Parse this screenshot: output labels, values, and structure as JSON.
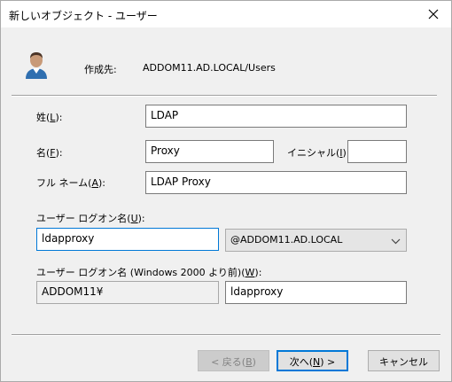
{
  "window": {
    "title": "新しいオブジェクト - ユーザー"
  },
  "header": {
    "create_in_label": "作成先:",
    "create_in_path": "ADDOM11.AD.LOCAL/Users"
  },
  "form": {
    "last_name": {
      "label_pre": "姓(",
      "mnemonic": "L",
      "label_post": "):",
      "value": "LDAP"
    },
    "first_name": {
      "label_pre": "名(",
      "mnemonic": "F",
      "label_post": "):",
      "value": "Proxy"
    },
    "initials": {
      "label_pre": "イニシャル(",
      "mnemonic": "I",
      "label_post": "):",
      "value": ""
    },
    "full_name": {
      "label_pre": "フル ネーム(",
      "mnemonic": "A",
      "label_post": "):",
      "value": "LDAP Proxy"
    },
    "logon_name": {
      "label_pre": "ユーザー ログオン名(",
      "mnemonic": "U",
      "label_post": "):",
      "value": "ldapproxy"
    },
    "upn_suffix": {
      "value": "@ADDOM11.AD.LOCAL"
    },
    "pre2000": {
      "label_pre": "ユーザー ログオン名 (Windows 2000 より前)(",
      "mnemonic": "W",
      "label_post": "):",
      "domain_value": "ADDOM11¥",
      "value": "ldapproxy"
    }
  },
  "buttons": {
    "back": {
      "label_pre": "< 戻る(",
      "mnemonic": "B",
      "label_post": ")"
    },
    "next": {
      "label_pre": "次へ(",
      "mnemonic": "N",
      "label_post": ") >"
    },
    "cancel": {
      "label": "キャンセル"
    }
  },
  "colors": {
    "accent": "#0078d7",
    "background": "#f0f0f0"
  }
}
